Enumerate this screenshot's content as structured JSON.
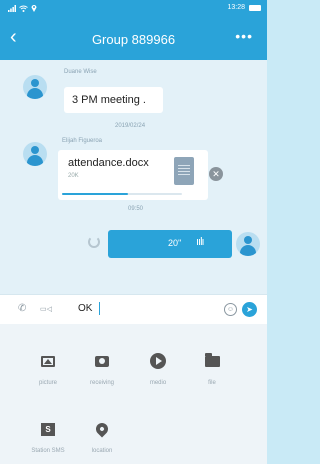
{
  "status_bar": {
    "time": "13:28",
    "signal_icon": "signal-icon",
    "wifi_icon": "wifi-icon",
    "location_icon": "location-pin-icon",
    "battery_icon": "battery-icon"
  },
  "header": {
    "back_glyph": "‹",
    "title": "Group 889966",
    "more_glyph": "•••"
  },
  "messages": {
    "first": {
      "sender": "Duane Wise",
      "text": "3 PM meeting ."
    },
    "date_divider": "2019/02/24",
    "second": {
      "sender": "Elijah Figueroa",
      "file_name": "attendance.docx",
      "file_size": "20K",
      "upload_progress": 0.55,
      "cancel_glyph": "✕"
    },
    "time_divider": "09:50",
    "voice": {
      "duration": "20''",
      "wave_glyph": "ıılı"
    }
  },
  "input_bar": {
    "phone_glyph": "✆",
    "video_glyph": "▭◁",
    "text": "OK",
    "emoji_glyph": "☺",
    "send_glyph": "➤"
  },
  "tools": [
    {
      "label": "picture",
      "icon": "picture-icon"
    },
    {
      "label": "receiving",
      "icon": "camera-icon"
    },
    {
      "label": "medio",
      "icon": "play-icon"
    },
    {
      "label": "file",
      "icon": "folder-icon"
    },
    {
      "label": "Station SMS",
      "icon": "sms-icon",
      "icon_text": "S"
    },
    {
      "label": "location",
      "icon": "location-pin-icon"
    }
  ],
  "colors": {
    "accent": "#2aa3d9",
    "chat_background": "#e3f1f8",
    "panel_background": "#eef4f8"
  }
}
